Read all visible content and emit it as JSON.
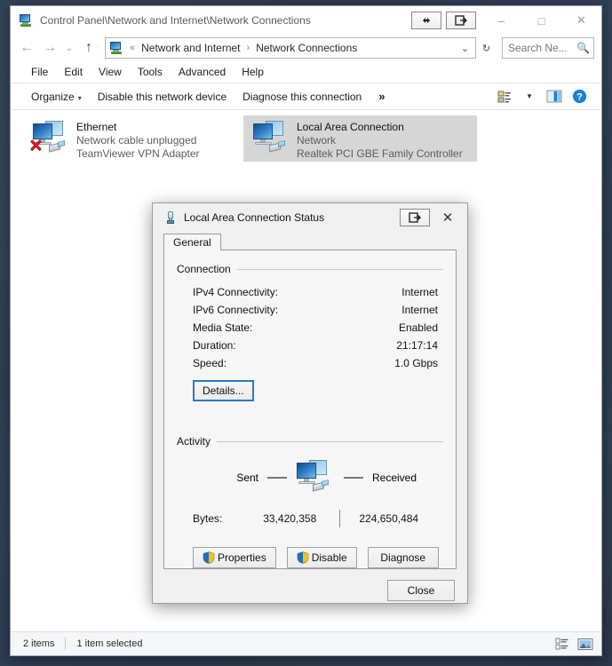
{
  "window": {
    "title": "Control Panel\\Network and Internet\\Network Connections",
    "title_icon": "network-connections-icon",
    "titlebar_extra_buttons": [
      {
        "name": "resize-horizontal-button",
        "glyph": "◀▶"
      },
      {
        "name": "move-window-button",
        "glyph": "⇥"
      }
    ],
    "controls": {
      "minimize": "–",
      "maximize": "□",
      "close": "✕"
    }
  },
  "addressbar": {
    "back_glyph": "←",
    "forward_glyph": "→",
    "history_glyph": "⌄",
    "up_glyph": "↑",
    "icon": "network-connections-icon",
    "overflow": "«",
    "crumbs": [
      "Network and Internet",
      "Network Connections"
    ],
    "separator": "›",
    "dropdown_glyph": "⌄",
    "refresh_glyph": "↻"
  },
  "search": {
    "value": "",
    "placeholder": "Search Ne...",
    "icon": "search-icon"
  },
  "menubar": {
    "items": [
      "File",
      "Edit",
      "View",
      "Tools",
      "Advanced",
      "Help"
    ]
  },
  "commandbar": {
    "organize": "Organize",
    "organize_caret": "▾",
    "disable_device": "Disable this network device",
    "diagnose_connection": "Diagnose this connection",
    "overflow": "»",
    "icons": [
      {
        "name": "change-view-icon"
      },
      {
        "name": "change-view-dropdown-icon",
        "glyph": "▾"
      },
      {
        "name": "preview-pane-icon"
      },
      {
        "name": "help-icon",
        "glyph": "?"
      }
    ]
  },
  "connections": [
    {
      "name": "Ethernet",
      "status": "Network cable unplugged",
      "adapter": "TeamViewer VPN Adapter",
      "selected": false,
      "disconnected": true,
      "icon": "network-adapter-icon"
    },
    {
      "name": "Local Area Connection",
      "status": "Network",
      "adapter": "Realtek PCI GBE Family Controller",
      "selected": true,
      "disconnected": false,
      "icon": "network-adapter-icon"
    }
  ],
  "statusbar": {
    "item_count": "2 items",
    "selection": "1 item selected",
    "view_icons": [
      {
        "name": "details-view-icon"
      },
      {
        "name": "large-icons-view-icon"
      }
    ]
  },
  "dialog": {
    "title": "Local Area Connection Status",
    "title_icon": "network-connector-icon",
    "titlebar_extra_button": {
      "name": "move-window-button",
      "glyph": "⇥"
    },
    "close_glyph": "✕",
    "tabs": [
      {
        "label": "General",
        "active": true
      }
    ],
    "connection_group": {
      "label": "Connection",
      "rows": [
        {
          "label": "IPv4 Connectivity:",
          "value": "Internet"
        },
        {
          "label": "IPv6 Connectivity:",
          "value": "Internet"
        },
        {
          "label": "Media State:",
          "value": "Enabled"
        },
        {
          "label": "Duration:",
          "value": "21:17:14"
        },
        {
          "label": "Speed:",
          "value": "1.0 Gbps"
        }
      ],
      "details_button": "Details..."
    },
    "activity_group": {
      "label": "Activity",
      "sent_label": "Sent",
      "received_label": "Received",
      "bytes_label": "Bytes:",
      "bytes_sent": "33,420,358",
      "bytes_received": "224,650,484",
      "icon": "network-activity-icon"
    },
    "buttons": {
      "properties": "Properties",
      "disable": "Disable",
      "diagnose": "Diagnose",
      "close": "Close",
      "shield_icon": "uac-shield-icon"
    }
  },
  "colors": {
    "accent": "#2a7ac0",
    "selection": "#d6d6d6",
    "help_blue": "#1b7fd4",
    "error_red": "#d41b1b",
    "desktop": "#2b3a4a"
  }
}
